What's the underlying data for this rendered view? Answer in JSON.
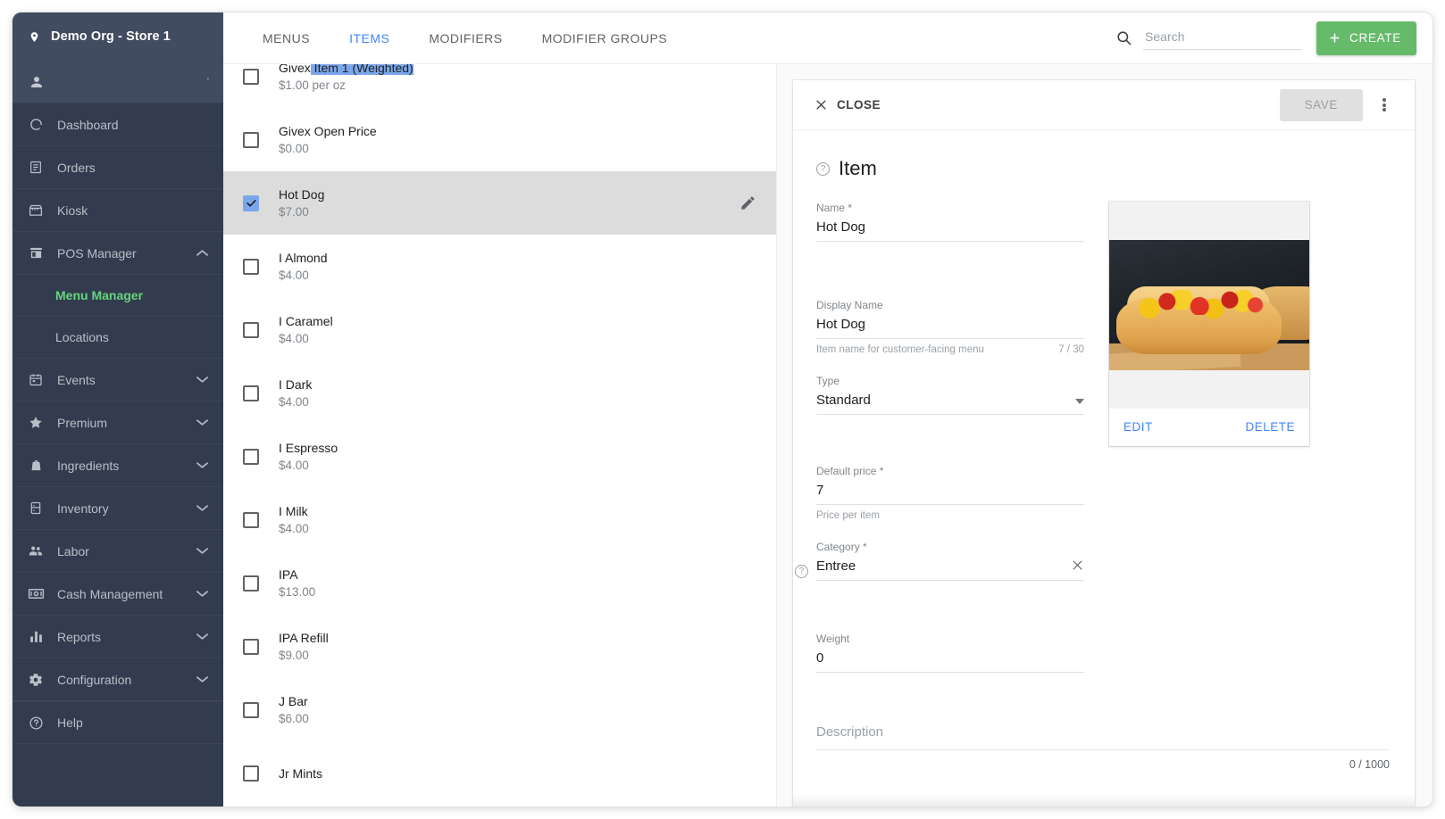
{
  "sidebar": {
    "org_title": "Demo Org - Store 1",
    "nav": [
      {
        "label": "Dashboard",
        "icon": "dashboard-icon",
        "expandable": false
      },
      {
        "label": "Orders",
        "icon": "orders-icon",
        "expandable": false
      },
      {
        "label": "Kiosk",
        "icon": "kiosk-icon",
        "expandable": false
      },
      {
        "label": "POS Manager",
        "icon": "pos-manager-icon",
        "expandable": true,
        "expanded": true
      },
      {
        "label": "Events",
        "icon": "calendar-icon",
        "expandable": true
      },
      {
        "label": "Premium",
        "icon": "star-icon",
        "expandable": true
      },
      {
        "label": "Ingredients",
        "icon": "basket-icon",
        "expandable": true
      },
      {
        "label": "Inventory",
        "icon": "inventory-icon",
        "expandable": true
      },
      {
        "label": "Labor",
        "icon": "people-icon",
        "expandable": true
      },
      {
        "label": "Cash Management",
        "icon": "cash-icon",
        "expandable": true
      },
      {
        "label": "Reports",
        "icon": "bar-chart-icon",
        "expandable": true
      },
      {
        "label": "Configuration",
        "icon": "gear-icon",
        "expandable": true
      }
    ],
    "pos_sub": [
      {
        "label": "Menu Manager",
        "active": true
      },
      {
        "label": "Locations",
        "active": false
      }
    ],
    "help_label": "Help"
  },
  "topbar": {
    "tabs": [
      {
        "label": "MENUS",
        "active": false
      },
      {
        "label": "ITEMS",
        "active": true
      },
      {
        "label": "MODIFIERS",
        "active": false
      },
      {
        "label": "MODIFIER GROUPS",
        "active": false
      }
    ],
    "search_placeholder": "Search",
    "search_value": "",
    "create_label": "CREATE",
    "create_color": "#66bb6a"
  },
  "item_list": [
    {
      "name": "Givex Item 1 (Weighted)",
      "price": "$1.00 per oz",
      "checked": false,
      "selected": false,
      "partial_highlight": true,
      "highlight_from": "Item 1 (Weighted)"
    },
    {
      "name": "Givex Open Price",
      "price": "$0.00",
      "checked": false,
      "selected": false
    },
    {
      "name": "Hot Dog",
      "price": "$7.00",
      "checked": true,
      "selected": true
    },
    {
      "name": "I Almond",
      "price": "$4.00",
      "checked": false,
      "selected": false
    },
    {
      "name": "I Caramel",
      "price": "$4.00",
      "checked": false,
      "selected": false
    },
    {
      "name": "I Dark",
      "price": "$4.00",
      "checked": false,
      "selected": false
    },
    {
      "name": "I Espresso",
      "price": "$4.00",
      "checked": false,
      "selected": false
    },
    {
      "name": "I Milk",
      "price": "$4.00",
      "checked": false,
      "selected": false
    },
    {
      "name": "IPA",
      "price": "$13.00",
      "checked": false,
      "selected": false
    },
    {
      "name": "IPA Refill",
      "price": "$9.00",
      "checked": false,
      "selected": false
    },
    {
      "name": "J Bar",
      "price": "$6.00",
      "checked": false,
      "selected": false
    },
    {
      "name": "Jr Mints",
      "price": "",
      "checked": false,
      "selected": false
    }
  ],
  "detail": {
    "close_label": "CLOSE",
    "save_label": "SAVE",
    "section_title": "Item",
    "fields": {
      "name_label": "Name",
      "name_value": "Hot Dog",
      "display_name_label": "Display Name",
      "display_name_value": "Hot Dog",
      "display_name_hint": "Item name for customer-facing menu",
      "display_name_count": "7 / 30",
      "type_label": "Type",
      "type_value": "Standard",
      "price_label": "Default price",
      "price_value": "7",
      "price_hint": "Price per item",
      "category_label": "Category",
      "category_value": "Entree",
      "weight_label": "Weight",
      "weight_value": "0",
      "description_placeholder": "Description",
      "description_count": "0 / 1000"
    },
    "image": {
      "alt": "hot-dog-photo",
      "edit_label": "EDIT",
      "delete_label": "DELETE",
      "link_color": "#4285f4"
    }
  }
}
